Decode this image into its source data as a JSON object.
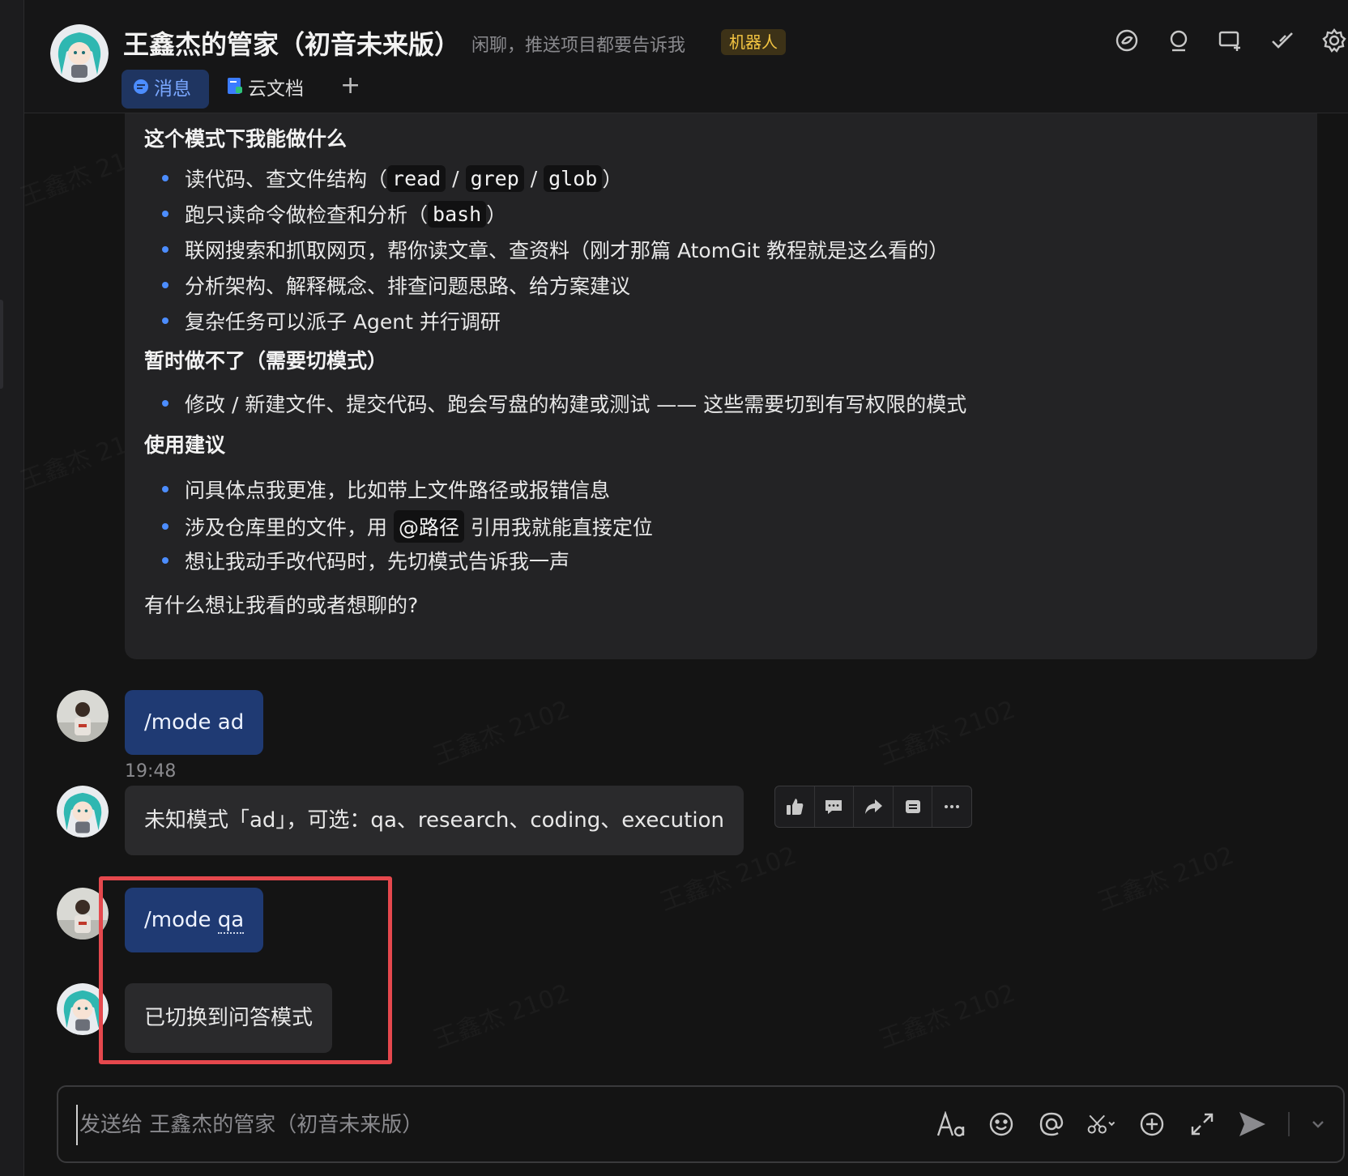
{
  "header": {
    "title": "王鑫杰的管家（初音未来版）",
    "subtitle": "闲聊，推送项目都要告诉我",
    "tag": "机器人",
    "tabs": [
      {
        "label": "消息"
      },
      {
        "label": "云文档"
      }
    ],
    "add_tab": "+"
  },
  "card": {
    "section1_title": "这个模式下我能做什么",
    "b1_pre": "读代码、查文件结构（",
    "b1_code1": "read",
    "b1_sep1": " / ",
    "b1_code2": "grep",
    "b1_sep2": " / ",
    "b1_code3": "glob",
    "b1_post": "）",
    "b2_pre": "跑只读命令做检查和分析（",
    "b2_code": "bash",
    "b2_post": "）",
    "b3": "联网搜索和抓取网页，帮你读文章、查资料（刚才那篇 AtomGit 教程就是这么看的）",
    "b4": "分析架构、解释概念、排查问题思路、给方案建议",
    "b5": "复杂任务可以派子 Agent 并行调研",
    "section2_title": "暂时做不了（需要切模式）",
    "b6": "修改 / 新建文件、提交代码、跑会写盘的构建或测试 —— 这些需要切到有写权限的模式",
    "section3_title": "使用建议",
    "b7": "问具体点我更准，比如带上文件路径或报错信息",
    "b8_pre": "涉及仓库里的文件，用 ",
    "b8_code": "@路径",
    "b8_post": " 引用我就能直接定位",
    "b9": "想让我动手改代码时，先切模式告诉我一声",
    "closing": "有什么想让我看的或者想聊的?"
  },
  "messages": {
    "user1": "/mode ad",
    "time1": "19:48",
    "bot1": "未知模式「ad」，可选：qa、research、coding、execution",
    "user2_pre": "/mode ",
    "user2_word": "qa",
    "bot2": "已切换到问答模式"
  },
  "composer": {
    "placeholder": "发送给 王鑫杰的管家（初音未来版）"
  },
  "watermark": "王鑫杰 2102",
  "colors": {
    "accent": "#4c8dff",
    "user_bubble": "#1f3a73",
    "bot_bubble": "#2a2a2c",
    "highlight": "#e5484d",
    "tag": "#f4c542"
  }
}
